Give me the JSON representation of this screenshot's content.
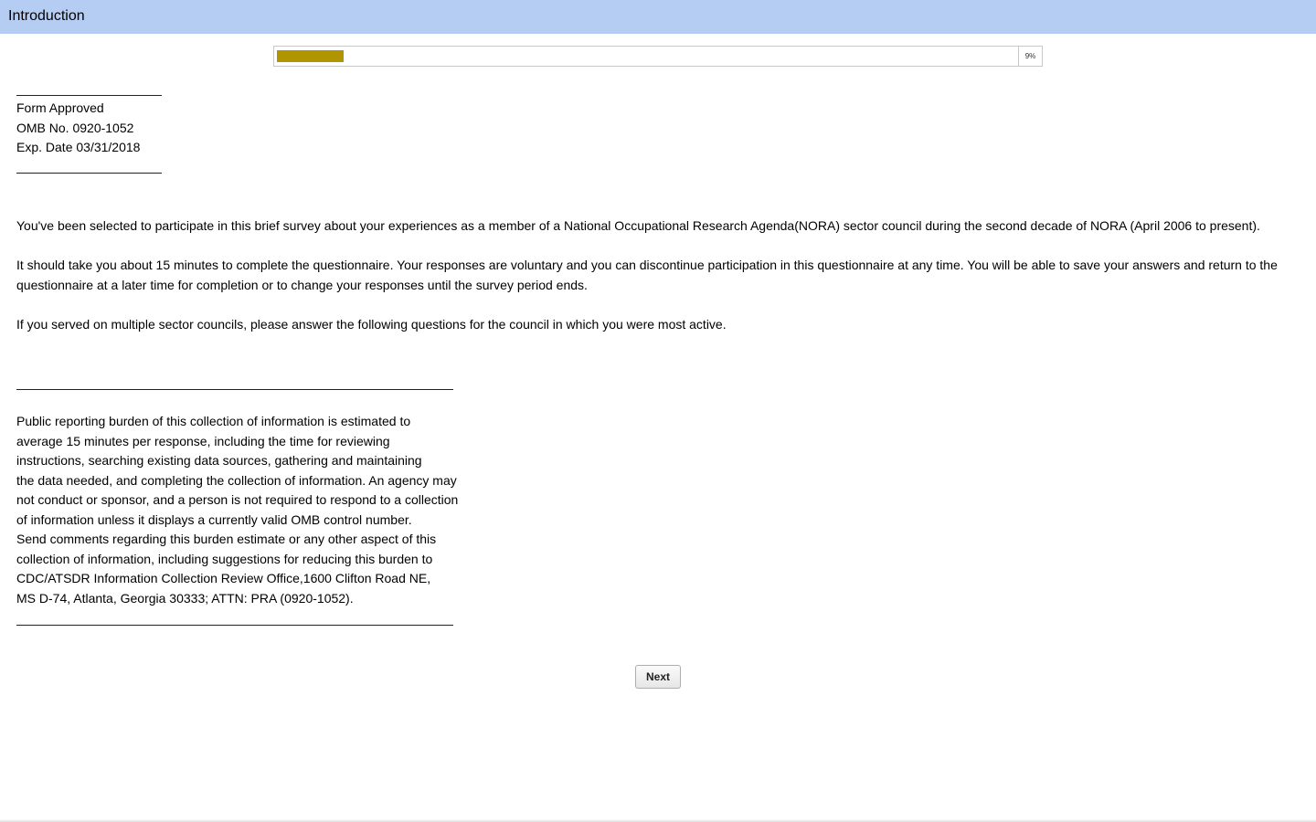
{
  "header": {
    "title": "Introduction"
  },
  "progress": {
    "percent": 9,
    "label": "9%"
  },
  "form_info": {
    "line1": "Form Approved",
    "line2": "OMB No. 0920-1052",
    "line3": "Exp. Date 03/31/2018"
  },
  "intro": {
    "para1": "You've been selected to participate in this brief survey about your experiences as a member of a National Occupational Research Agenda(NORA) sector council during the second decade of NORA (April 2006 to present).",
    "para2": "It should take you about 15 minutes to complete the questionnaire. Your responses are voluntary and you can discontinue participation in this questionnaire at any time. You will be able to save your answers and return to the questionnaire at a later time for completion or to change your responses until the survey period ends.",
    "para3": "If you served on multiple sector councils, please answer the following questions for the council in which you were most active."
  },
  "burden": {
    "lines": [
      "Public reporting burden of this collection of information is estimated to",
      "average 15 minutes per response, including the time for reviewing",
      "instructions, searching existing data sources, gathering and maintaining",
      "the data needed, and completing the collection of information. An agency may",
      "not conduct or sponsor, and a person is not required to respond to a collection",
      "of information unless it displays a currently valid OMB control number.",
      "Send comments regarding this burden estimate or any other aspect of this",
      "collection of information, including suggestions for reducing this burden to",
      "CDC/ATSDR Information Collection Review Office,1600 Clifton Road NE,",
      "MS D-74, Atlanta, Georgia 30333; ATTN: PRA (0920-1052)."
    ]
  },
  "actions": {
    "next_label": "Next"
  },
  "colors": {
    "header_bg": "#b5cdf2",
    "progress_fill": "#b09400"
  }
}
